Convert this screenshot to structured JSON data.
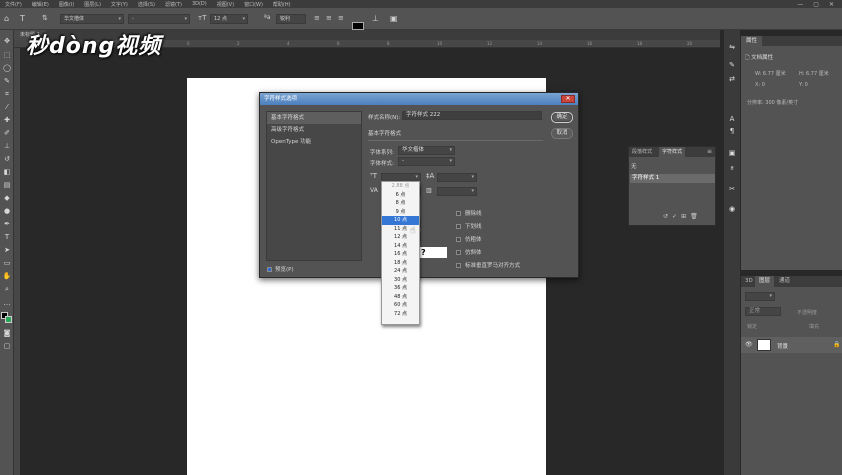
{
  "menu": [
    "文件(F)",
    "编辑(E)",
    "图像(I)",
    "图层(L)",
    "文字(Y)",
    "选择(S)",
    "滤镜(T)",
    "3D(D)",
    "视图(V)",
    "窗口(W)",
    "帮助(H)"
  ],
  "window_controls": [
    "—",
    "▢",
    "✕"
  ],
  "options_bar": {
    "font_family": "华文楷体",
    "font_style": "-",
    "font_size": "12 点",
    "antialias": "锐利"
  },
  "doc_tab": "未标题-1",
  "watermark": "秒dòng视频",
  "ruler_ticks": [
    "0",
    "2",
    "4",
    "6",
    "8",
    "10",
    "12",
    "14",
    "16",
    "18",
    "20",
    "22",
    "24",
    "26"
  ],
  "dialog": {
    "title": "字符样式选项",
    "close": "✕",
    "categories": [
      "基本字符格式",
      "高级字符格式",
      "OpenType 功能"
    ],
    "preview_label": "预览(P)",
    "style_name_label": "样式名称(N):",
    "style_name_value": "字符样式 222",
    "section_title": "基本字符格式",
    "font_family_label": "字体系列:",
    "font_family_value": "华文楷体",
    "font_style_label": "字体样式:",
    "font_style_value": "-",
    "ok_label": "确定",
    "cancel_label": "取消",
    "checkboxes": [
      "删除线",
      "下划线",
      "仿粗体",
      "仿斜体",
      "标准垂直罗马对齐方式"
    ]
  },
  "size_dropdown": {
    "items": [
      "2.88 点",
      "6 点",
      "8 点",
      "9 点",
      "10 点",
      "11 点",
      "12 点",
      "14 点",
      "16 点",
      "18 点",
      "24 点",
      "30 点",
      "36 点",
      "48 点",
      "60 点",
      "72 点"
    ],
    "selected_index": 4,
    "disabled_index": 0
  },
  "preview_text": "?",
  "properties_panel": {
    "tab": "属性",
    "doc_label": "文档属性",
    "w": "W:  6.77 厘米",
    "h": "H:  6.77 厘米",
    "x": "X:  0",
    "y": "Y:  0",
    "resolution": "分辨率: 300 像素/英寸"
  },
  "char_style_panel": {
    "tabs": [
      "段落样式",
      "字符样式"
    ],
    "rows": [
      "无",
      "字符样式 1"
    ]
  },
  "layers_panel": {
    "tabs": [
      "3D",
      "图层",
      "通道"
    ],
    "kind": "正常",
    "opacity": "不透明度",
    "fill": "填充",
    "lock": "锁定",
    "layer_name": "背景"
  }
}
